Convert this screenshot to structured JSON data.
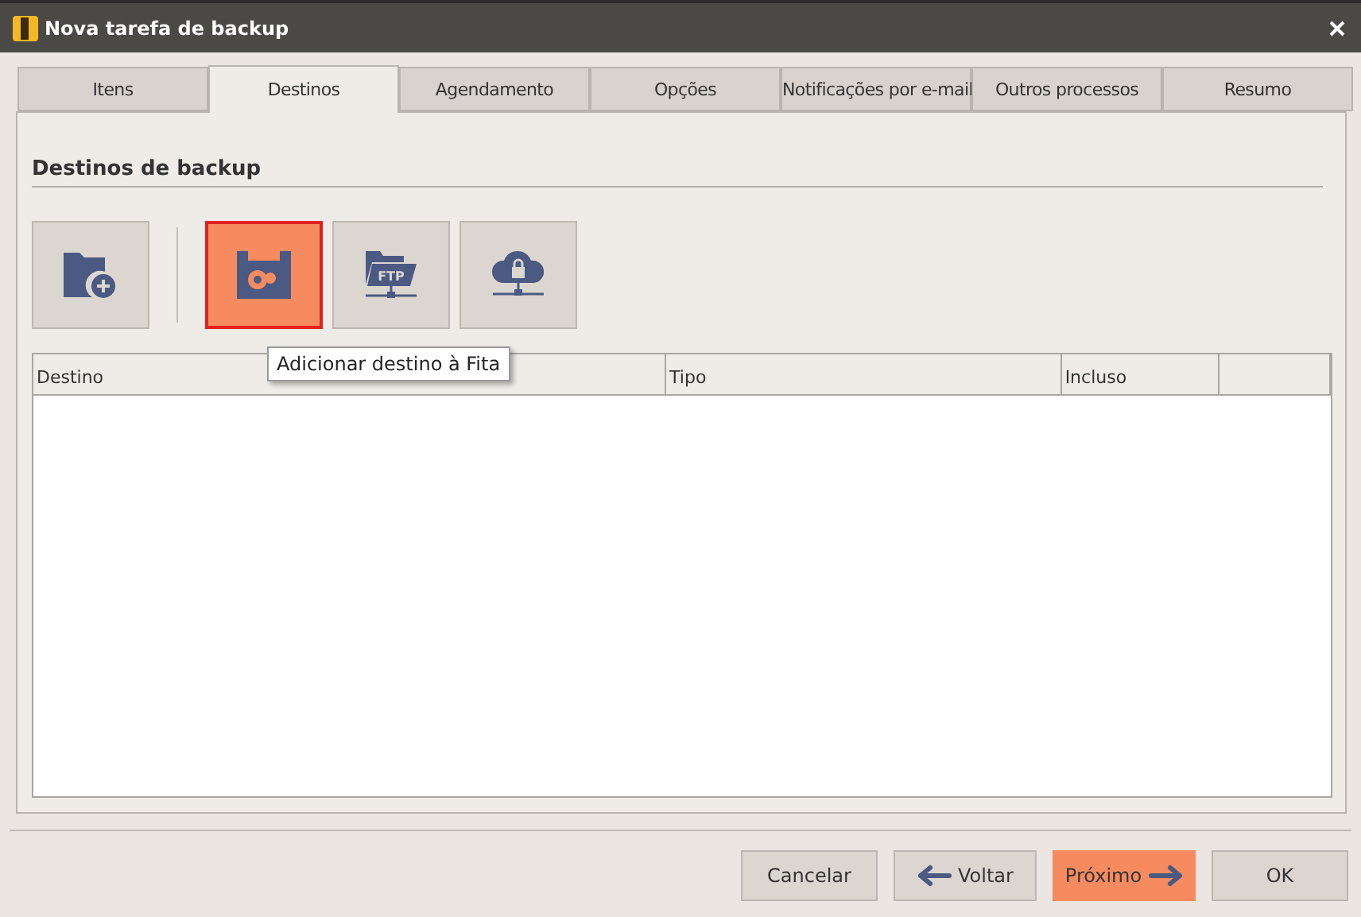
{
  "window": {
    "title": "Nova tarefa de backup"
  },
  "tabs": [
    {
      "label": "Itens",
      "selected": false
    },
    {
      "label": "Destinos",
      "selected": true
    },
    {
      "label": "Agendamento",
      "selected": false
    },
    {
      "label": "Opções",
      "selected": false
    },
    {
      "label": "Notificações por e-mail",
      "selected": false
    },
    {
      "label": "Outros processos",
      "selected": false
    },
    {
      "label": "Resumo",
      "selected": false
    }
  ],
  "section_title": "Destinos de backup",
  "tools": [
    {
      "kind": "folder",
      "selected": false
    },
    {
      "kind": "tape",
      "selected": true
    },
    {
      "kind": "ftp",
      "selected": false,
      "icon_text": "FTP"
    },
    {
      "kind": "cloud",
      "selected": false
    }
  ],
  "tooltip": "Adicionar destino à Fita",
  "table": {
    "columns": [
      "Destino",
      "Tipo",
      "Incluso"
    ]
  },
  "buttons": [
    {
      "label": "Cancelar",
      "kind": "plain",
      "highlighted": false
    },
    {
      "label": "Voltar",
      "kind": "back",
      "highlighted": false
    },
    {
      "label": "Próximo",
      "kind": "next",
      "highlighted": true
    },
    {
      "label": "OK",
      "kind": "plain",
      "highlighted": false
    }
  ]
}
